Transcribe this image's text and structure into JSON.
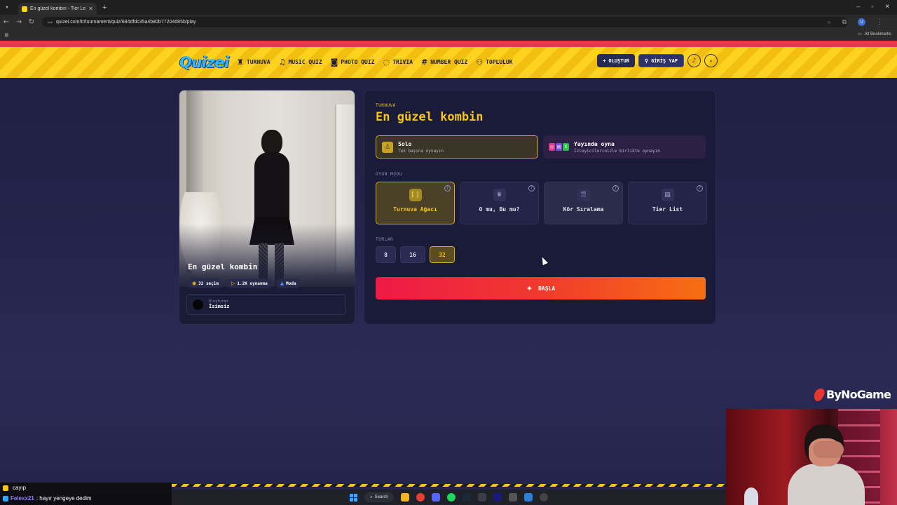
{
  "browser": {
    "tab_title": "En güzel kombin - Tier List, Kö",
    "url": "quizei.com/tr/tournament/quiz/684dfdc35a4b80b77204d85b/play",
    "all_bookmarks": "All Bookmarks",
    "profile_initial": "U"
  },
  "site": {
    "logo": "Quizei",
    "nav": [
      {
        "label": "TURNUVA",
        "icon": "trophy-icon"
      },
      {
        "label": "MUSIC QUIZ",
        "icon": "music-note-icon"
      },
      {
        "label": "PHOTO QUIZ",
        "icon": "camera-icon"
      },
      {
        "label": "TRIVIA",
        "icon": "chat-question-icon"
      },
      {
        "label": "NUMBER QUIZ",
        "icon": "hash-icon"
      },
      {
        "label": "TOPLULUK",
        "icon": "users-icon"
      }
    ],
    "create_label": "OLUŞTUR",
    "login_label": "GİRİŞ YAP"
  },
  "quiz": {
    "title": "En güzel kombin",
    "choices": "32 seçim",
    "plays": "1.2K oynanma",
    "category": "Moda",
    "creator_label": "Oluşturan",
    "creator_name": "İsimsiz"
  },
  "setup": {
    "kicker": "TURNUVA",
    "title": "En güzel kombin",
    "play_modes": [
      {
        "title": "Solo",
        "subtitle": "Tek başına oynayın",
        "selected": true
      },
      {
        "title": "Yayında oyna",
        "subtitle": "İzleyicilerinizle birlikte oynayın",
        "selected": false
      }
    ],
    "game_mode_label": "OYUN MODU",
    "game_modes": [
      {
        "label": "Turnuva Ağacı",
        "icon": "bracket-icon",
        "selected": true
      },
      {
        "label": "O mu, Bu mu?",
        "icon": "crown-icon",
        "selected": false
      },
      {
        "label": "Kör Sıralama",
        "icon": "list-icon",
        "selected": false
      },
      {
        "label": "Tier List",
        "icon": "tiers-icon",
        "selected": false
      }
    ],
    "rounds_label": "TURLAR",
    "rounds": [
      "8",
      "16",
      "32"
    ],
    "selected_round": "32",
    "start_label": "BAŞLA"
  },
  "overlay": {
    "brand": "ByNoGame",
    "chat": [
      {
        "user": "",
        "message": "cayıp"
      },
      {
        "user": "Felexx21",
        "message": ": hayır yengeye dedim"
      }
    ]
  },
  "taskbar": {
    "search_label": "Search"
  },
  "colors": {
    "accent_yellow": "#f5c518",
    "nav_yellow": "#ffd21f",
    "red_strip": "#e63946",
    "start_gradient_from": "#ee1a47",
    "start_gradient_to": "#f76f12",
    "background": "#1e1f3f"
  }
}
